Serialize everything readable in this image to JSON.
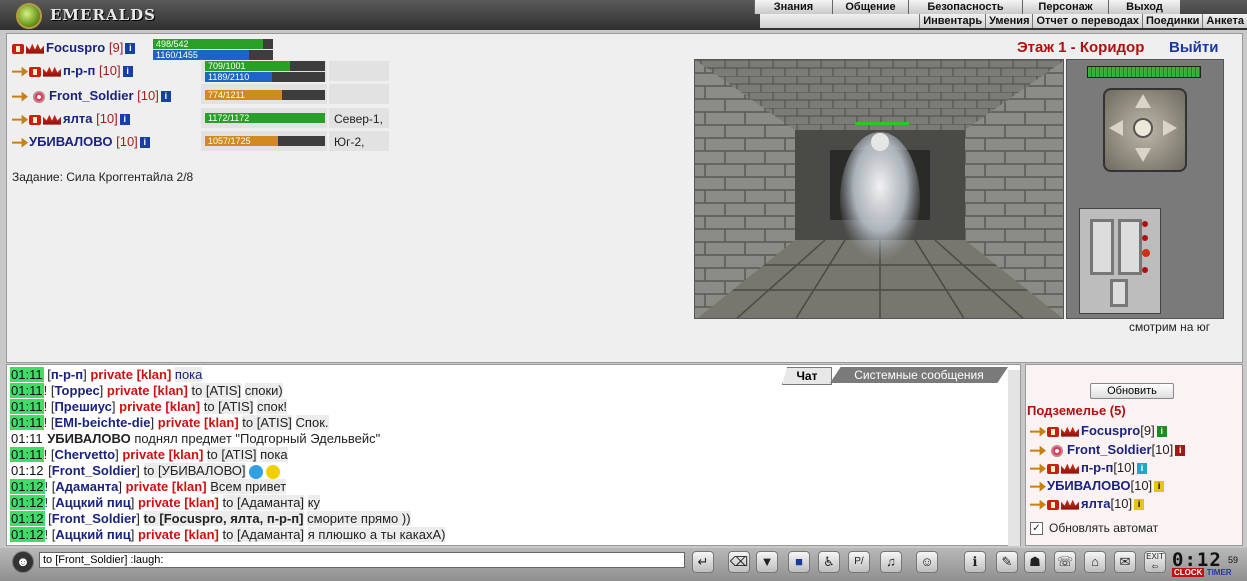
{
  "app": {
    "logo_text": "EMERALDS"
  },
  "top_menu": [
    {
      "label": "Знания"
    },
    {
      "label": "Общение"
    },
    {
      "label": "Безопасность"
    },
    {
      "label": "Персонаж"
    },
    {
      "label": "Выход"
    }
  ],
  "sub_menu": [
    {
      "label": "Инвентарь"
    },
    {
      "label": "Умения"
    },
    {
      "label": "Отчет о переводах"
    },
    {
      "label": "Поединки"
    },
    {
      "label": "Анкета"
    }
  ],
  "location": {
    "floor": "Этаж 1 - Коридор",
    "exit": "Выйти",
    "looking": "смотрим на юг"
  },
  "party": [
    {
      "name": "Focuspro",
      "level": "[9]",
      "hp": "498/542",
      "hp_frac": 0.92,
      "mp": "1160/1455",
      "mp_frac": 0.8,
      "dir": ""
    },
    {
      "name": "п-р-п",
      "level": "[10]",
      "hp": "709/1001",
      "hp_frac": 0.71,
      "mp": "1189/2110",
      "mp_frac": 0.56,
      "dir": ""
    },
    {
      "name": "Front_Soldier",
      "level": "[10]",
      "hp": "774/1211",
      "hp_frac": 0.64,
      "mp": "",
      "dir": ""
    },
    {
      "name": "ялта",
      "level": "[10]",
      "hp": "1172/1172",
      "hp_frac": 1.0,
      "mp": "",
      "dir": "Север-1,"
    },
    {
      "name": "УБИВАЛОВО",
      "level": "[10]",
      "hp": "1057/1725",
      "hp_frac": 0.61,
      "mp": "",
      "dir": "Юг-2,"
    }
  ],
  "task": "Задание: Сила Кроггентайла 2/8",
  "chat": {
    "tabs": {
      "chat": "Чат",
      "system": "Системные сообщения"
    },
    "lines": [
      {
        "time": "01:11",
        "mark": "",
        "sender": "п-р-п",
        "priv": "private [klan]",
        "to": "",
        "text": "пока",
        "hl": true
      },
      {
        "time": "01:11",
        "mark": "!",
        "sender": "Торрес",
        "priv": "private [klan]",
        "to": "to [ATIS]",
        "text": "споки)",
        "hl": true
      },
      {
        "time": "01:11",
        "mark": "!",
        "sender": "Прешиус",
        "priv": "private [klan]",
        "to": "to [ATIS]",
        "text": "спок!",
        "hl": true
      },
      {
        "time": "01:11",
        "mark": "!",
        "sender": "EMI-beichte-die",
        "priv": "private [klan]",
        "to": "to [ATIS]",
        "text": "Спок.",
        "hl": true
      },
      {
        "time": "01:11",
        "system_actor": "УБИВАЛОВО",
        "system_text": "поднял предмет \"Подгорный Эдельвейс\"",
        "hl": false
      },
      {
        "time": "01:11",
        "mark": "!",
        "sender": "Chervetto",
        "priv": "private [klan]",
        "to": "to [ATIS]",
        "text": "пока",
        "hl": true
      },
      {
        "time": "01:12",
        "mark": "",
        "sender": "Front_Soldier",
        "priv": "",
        "to": "to [УБИВАЛОВО]",
        "text": "",
        "smiles": true,
        "hl": false
      },
      {
        "time": "01:12",
        "mark": "!",
        "sender": "Адаманта",
        "priv": "private [klan]",
        "to": "",
        "text": "Всем привет",
        "hl": true
      },
      {
        "time": "01:12",
        "mark": "!",
        "sender": "Аццкий пиц",
        "priv": "private [klan]",
        "to": "to [Адаманта]",
        "text": "ку",
        "hl": true
      },
      {
        "time": "01:12",
        "mark": "",
        "sender": "Front_Soldier",
        "priv": "",
        "to_bold": "to [Focuspro, ялта, п-р-п]",
        "text": "сморите прямо ))",
        "hl": true
      },
      {
        "time": "01:12",
        "mark": "!",
        "sender": "Аццкий пиц",
        "priv": "private [klan]",
        "to": "to [Адаманта]",
        "text": "я плюшко а ты какахА)",
        "hl": true
      }
    ]
  },
  "online": {
    "refresh": "Обновить",
    "title": "Подземелье (5)",
    "users": [
      {
        "name": "Focuspro",
        "level": "[9]",
        "badge": "green"
      },
      {
        "name": "Front_Soldier",
        "level": "[10]",
        "badge": "red"
      },
      {
        "name": "п-р-п",
        "level": "[10]",
        "badge": "cyan"
      },
      {
        "name": "УБИВАЛОВО",
        "level": "[10]",
        "badge": "yellow"
      },
      {
        "name": "ялта",
        "level": "[10]",
        "badge": "yellow"
      }
    ],
    "auto_label": "Обновлять автомат"
  },
  "input": {
    "value": "to [Front_Soldier] :laugh:"
  },
  "clock": {
    "time": "0:12",
    "seconds": "59",
    "clock_label": "CLOCK",
    "timer_label": "TIMER"
  }
}
